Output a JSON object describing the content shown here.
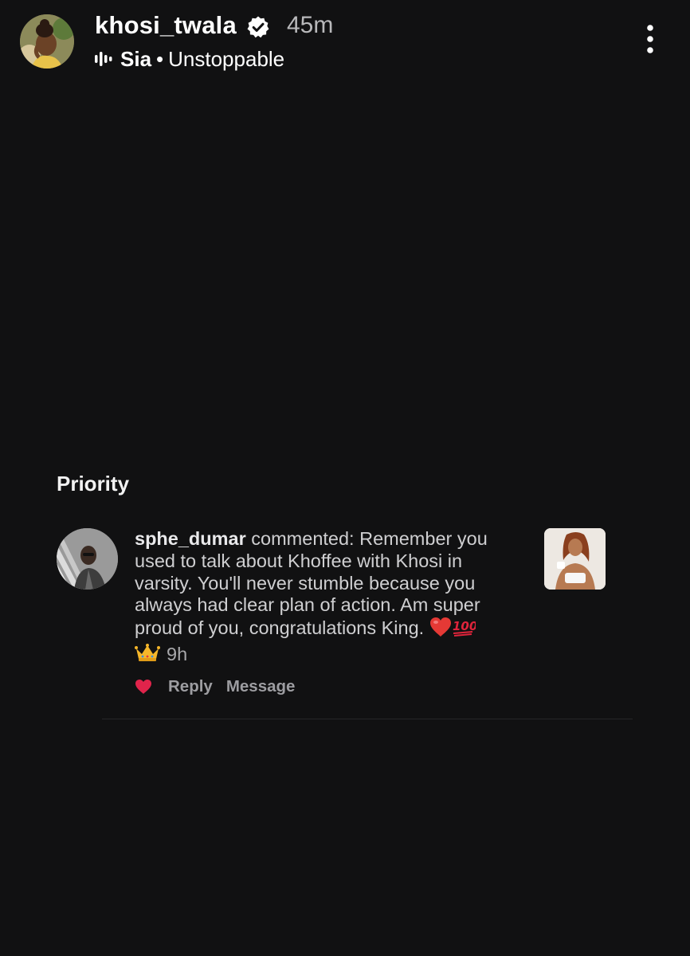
{
  "story": {
    "username": "khosi_twala",
    "time_ago": "45m",
    "music": {
      "artist": "Sia",
      "separator": "•",
      "song": "Unstoppable"
    },
    "icons": {
      "verified": "verified-badge-icon",
      "music": "audio-equalizer-icon",
      "more": "more-vertical-icon"
    }
  },
  "priority": {
    "title": "Priority",
    "comment": {
      "username": "sphe_dumar",
      "text": " commented: Remember you used to talk about Khoffee with Khosi in varsity. You'll never stumble because you always had clear plan of action. Am super proud of you, congratulations King. ",
      "emojis": [
        "red-heart-icon",
        "hundred-points-icon",
        "crown-icon"
      ],
      "time_ago": "9h",
      "actions": {
        "reply": "Reply",
        "message": "Message"
      }
    }
  },
  "colors": {
    "background": "#111112",
    "text_primary": "#ffffff",
    "text_secondary": "#b9b9bb",
    "comment_text": "#cfcfd1",
    "action_text": "#9d9da1",
    "like_heart": "#e0244b"
  }
}
